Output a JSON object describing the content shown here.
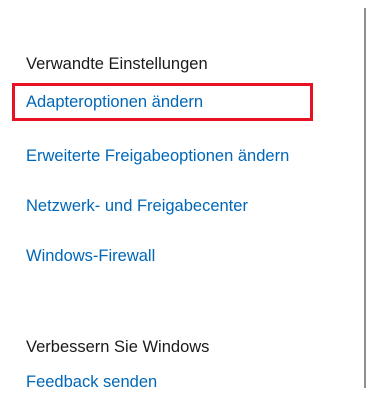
{
  "related_settings": {
    "heading": "Verwandte Einstellungen",
    "links": [
      {
        "label": "Adapteroptionen ändern"
      },
      {
        "label": "Erweiterte Freigabeoptionen ändern"
      },
      {
        "label": "Netzwerk- und Freigabecenter"
      },
      {
        "label": "Windows-Firewall"
      }
    ]
  },
  "improve_windows": {
    "heading": "Verbessern Sie Windows",
    "links": [
      {
        "label": "Feedback senden"
      }
    ]
  },
  "colors": {
    "link": "#0067b8",
    "highlight": "#e81123",
    "text": "#1a1a1a"
  }
}
